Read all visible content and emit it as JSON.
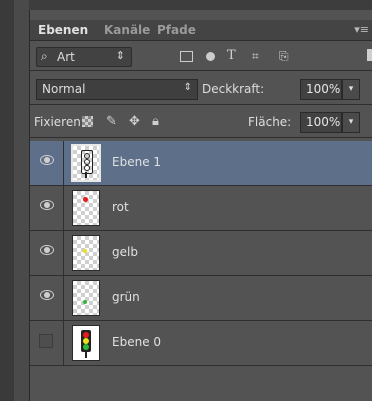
{
  "tabs": [
    {
      "label": "Ebenen",
      "active": true
    },
    {
      "label": "Kanäle",
      "active": false
    },
    {
      "label": "Pfade",
      "active": false
    }
  ],
  "filter": {
    "kind": "Art"
  },
  "blend": {
    "mode": "Normal",
    "opacity_label": "Deckkraft:",
    "opacity": "100%"
  },
  "lock": {
    "label": "Fixieren:",
    "fill_label": "Fläche:",
    "fill": "100%"
  },
  "layers": [
    {
      "name": "Ebene 1",
      "selected": true,
      "visible": true,
      "thumb": "traffic-light-outline"
    },
    {
      "name": "rot",
      "selected": false,
      "visible": true,
      "thumb": "red-dot",
      "dot_color": "#e81b1b"
    },
    {
      "name": "gelb",
      "selected": false,
      "visible": true,
      "thumb": "yellow-dot",
      "dot_color": "#e8e21b"
    },
    {
      "name": "grün",
      "selected": false,
      "visible": true,
      "thumb": "green-dot",
      "dot_color": "#2fb83a"
    },
    {
      "name": "Ebene 0",
      "selected": false,
      "visible": false,
      "thumb": "traffic-light-colored"
    }
  ],
  "colors": {
    "selected_row": "#5d6f89",
    "panel": "#535353"
  }
}
